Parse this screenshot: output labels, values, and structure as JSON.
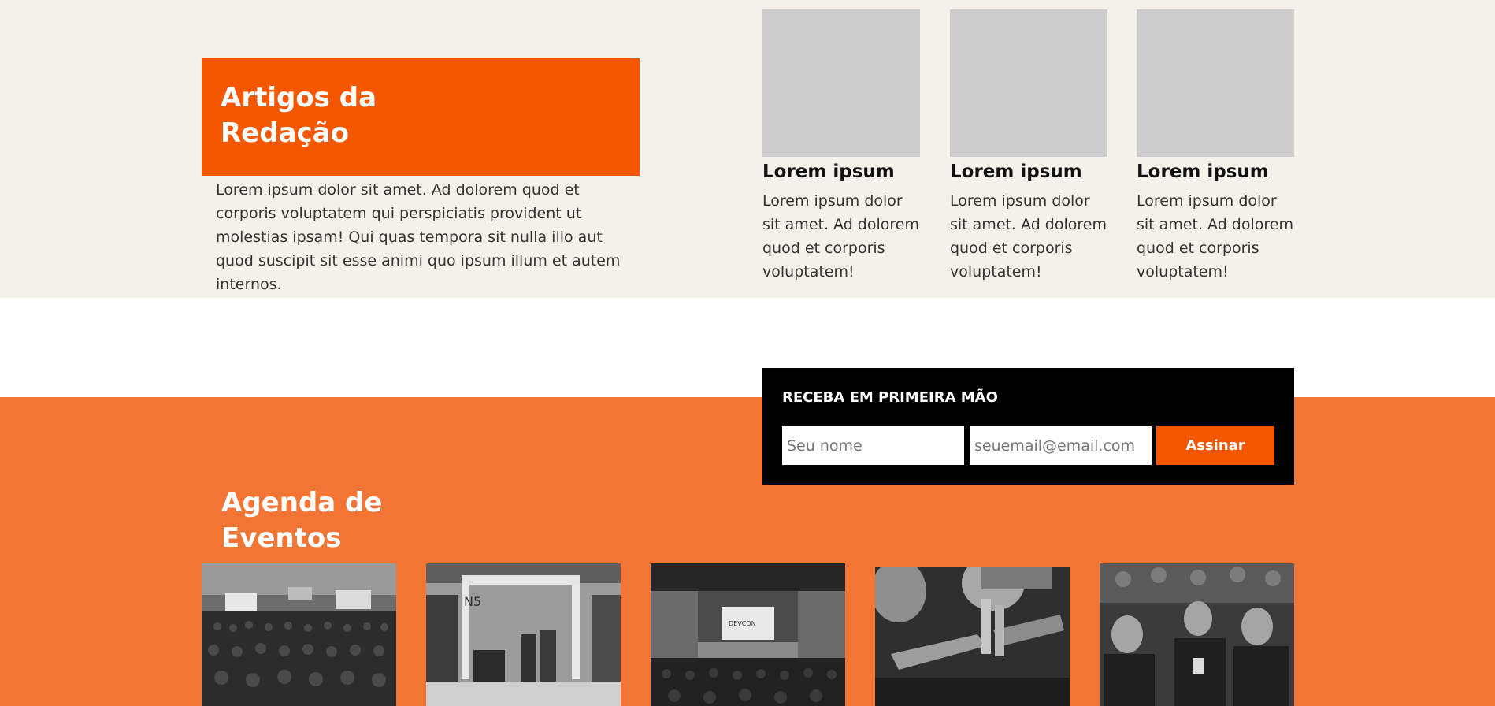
{
  "artigos": {
    "title": "Artigos da Redação",
    "description": "Lorem ipsum dolor sit amet. Ad dolorem quod et corporis voluptatem qui perspiciatis provident ut molestias ipsam! Qui quas tempora sit nulla illo aut quod suscipit sit esse animi quo ipsum illum et autem internos.",
    "cards": [
      {
        "title": "Lorem ipsum",
        "text": "Lorem ipsum dolor sit amet. Ad dolorem quod et corporis voluptatem!"
      },
      {
        "title": "Lorem ipsum",
        "text": "Lorem ipsum dolor sit amet. Ad dolorem quod et corporis voluptatem!"
      },
      {
        "title": "Lorem ipsum",
        "text": "Lorem ipsum dolor sit amet. Ad dolorem quod et corporis voluptatem!"
      }
    ]
  },
  "newsletter": {
    "title": "RECEBA EM PRIMEIRA MÃO",
    "name_placeholder": "Seu nome",
    "email_placeholder": "seuemail@email.com",
    "button_label": "Assinar"
  },
  "agenda": {
    "title": "Agenda de Eventos",
    "photos": [
      {
        "sign_text": ""
      },
      {
        "sign_text": "N5"
      },
      {
        "sign_text": "DEVCON"
      },
      {
        "sign_text": ""
      },
      {
        "sign_text": ""
      }
    ]
  },
  "colors": {
    "accent": "#f55600",
    "agenda_bg": "#f37536",
    "artigos_bg": "#f4f1eb",
    "newsletter_bg": "#000000"
  }
}
